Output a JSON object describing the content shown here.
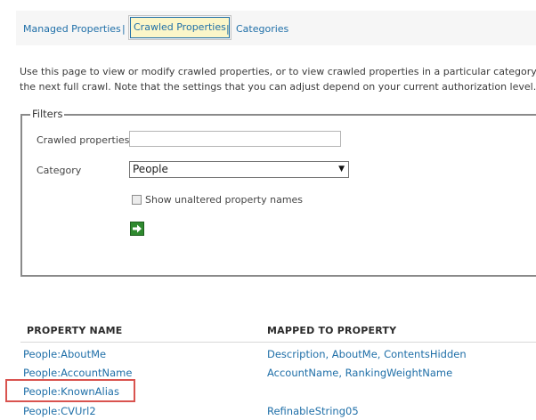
{
  "nav": {
    "managed_label": "Managed Properties",
    "sep1": "|",
    "crawled_label": "Crawled Properties",
    "sep2": "|",
    "categories_label": "Categories"
  },
  "description": {
    "line1": "Use this page to view or modify crawled properties, or to view crawled properties in a particular category. Char",
    "line2": "the next full crawl. Note that the settings that you can adjust depend on your current authorization level."
  },
  "filters": {
    "legend": "Filters",
    "crawled_label": "Crawled properties",
    "crawled_value": "",
    "category_label": "Category",
    "category_value": "People",
    "checkbox_label": "Show unaltered property names",
    "checkbox_checked": false
  },
  "table": {
    "headers": [
      "PROPERTY NAME",
      "MAPPED TO PROPERTY"
    ],
    "rows": [
      {
        "name": "People:AboutMe",
        "mapped": "Description, AboutMe, ContentsHidden"
      },
      {
        "name": "People:AccountName",
        "mapped": "AccountName, RankingWeightName"
      },
      {
        "name": "People:KnownAlias",
        "mapped": ""
      },
      {
        "name": "People:CVUrl2",
        "mapped": "RefinableString05"
      }
    ]
  },
  "colors": {
    "link": "#1f6fa8",
    "selected_tab_bg": "#fbf6c9",
    "highlight_border": "#d9534f",
    "go_button": "#2f8a2f"
  },
  "icons": {
    "go": "arrow-right-icon",
    "select": "chevron-down-icon"
  }
}
